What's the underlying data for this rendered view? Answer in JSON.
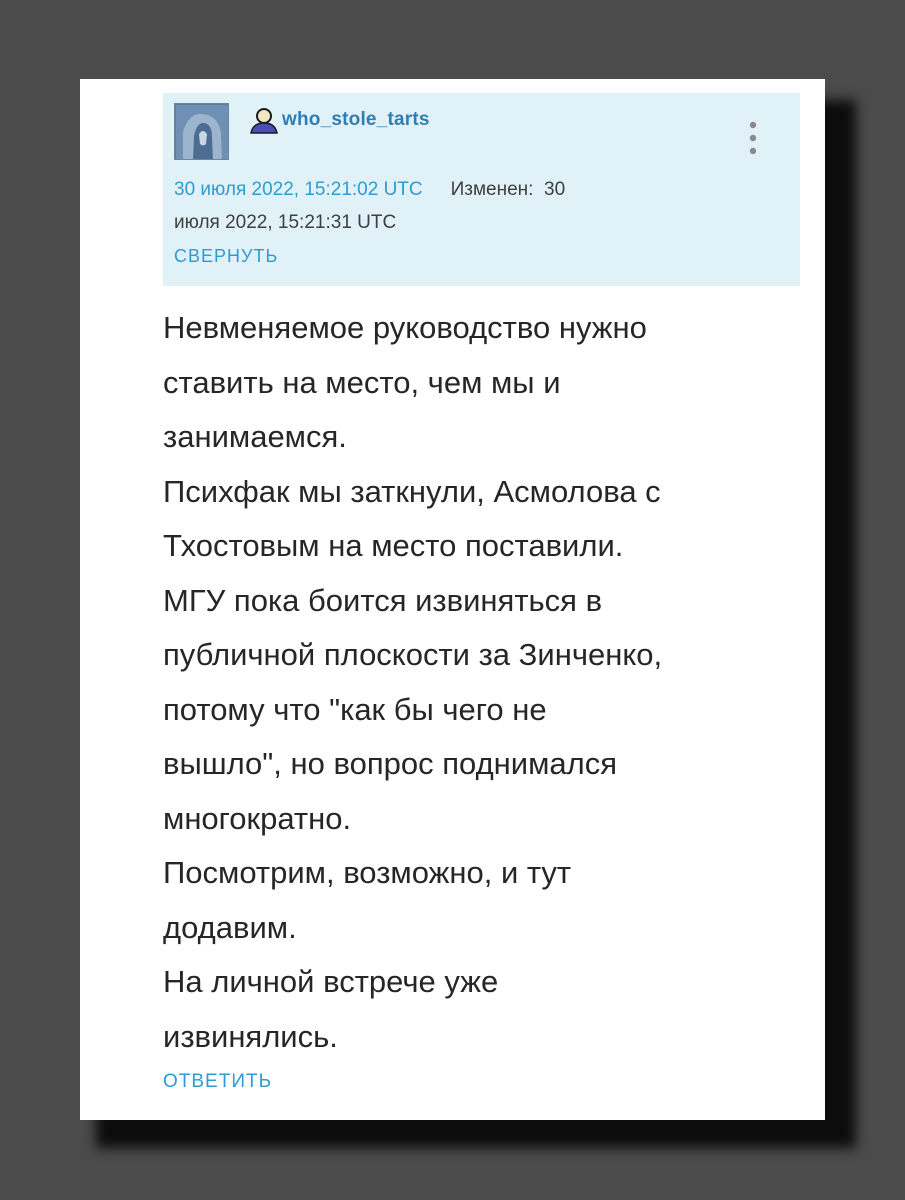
{
  "comment": {
    "username": "who_stole_tarts",
    "posted_date": "30 июля 2022, 15:21:02 UTC",
    "edited_label": "Изменен:",
    "edited_date_part1": "30",
    "edited_date_part2": "июля 2022, 15:21:31 UTC",
    "collapse_label": "СВЕРНУТЬ",
    "body_lines": [
      "Невменяемое руководство нужно",
      "ставить на место, чем мы и",
      "занимаемся.",
      "Психфак мы заткнули, Асмолова с",
      "Тхостовым на место поставили.",
      "МГУ пока боится извиняться в",
      "публичной плоскости за Зинченко,",
      "потому что \"как бы чего не",
      "вышло\", но вопрос поднимался",
      "многократно.",
      "Посмотрим, возможно, и тут",
      "додавим.",
      "На личной встрече уже",
      "извинялись."
    ],
    "reply_label": "ОТВЕТИТЬ",
    "icons": {
      "user": "user-icon",
      "menu": "more-vertical-icon"
    },
    "colors": {
      "link": "#2f9bd0",
      "username": "#2e7fb4",
      "header_bg": "#e1f1f8",
      "text": "#262626"
    }
  }
}
